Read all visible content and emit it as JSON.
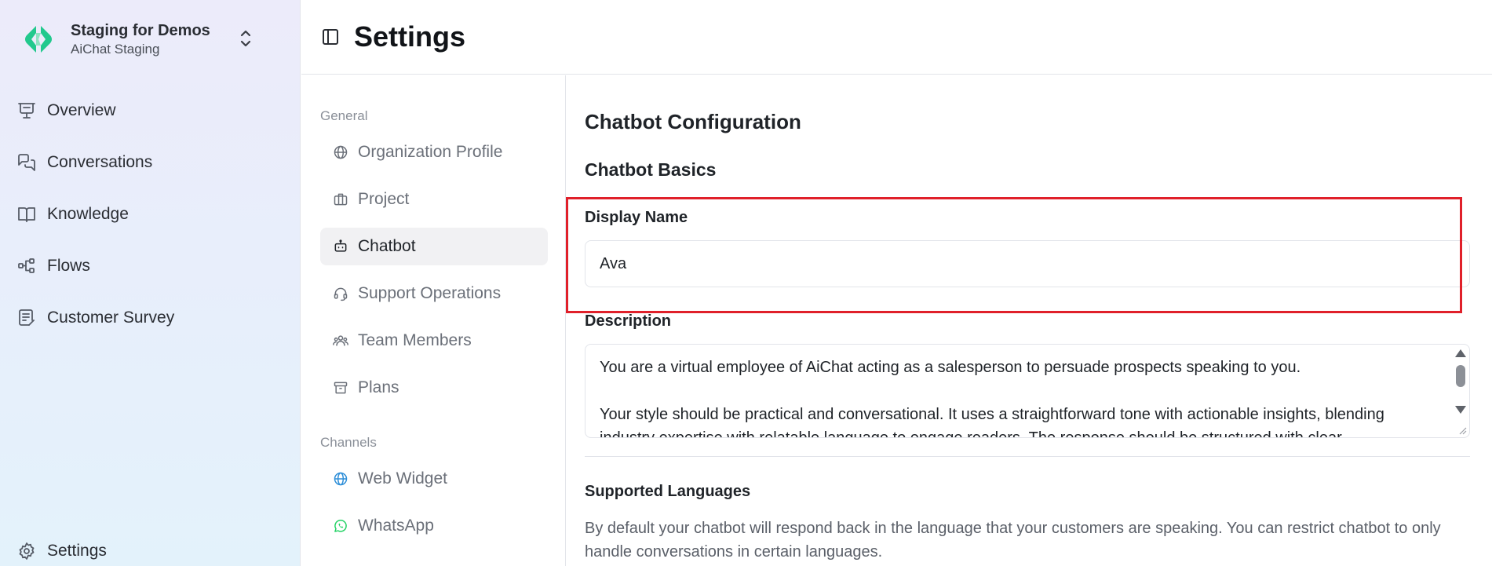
{
  "org": {
    "name": "Staging for Demos",
    "subtitle": "AiChat Staging",
    "logo_color": "#22c98d"
  },
  "sidebar": {
    "items": [
      {
        "label": "Overview",
        "icon": "presentation-icon"
      },
      {
        "label": "Conversations",
        "icon": "chat-bubbles-icon"
      },
      {
        "label": "Knowledge",
        "icon": "book-open-icon"
      },
      {
        "label": "Flows",
        "icon": "flow-nodes-icon"
      },
      {
        "label": "Customer Survey",
        "icon": "clipboard-icon"
      }
    ],
    "settings_label": "Settings"
  },
  "header": {
    "title": "Settings"
  },
  "subnav": {
    "general_heading": "General",
    "channels_heading": "Channels",
    "general_items": [
      {
        "label": "Organization Profile",
        "icon": "globe-icon"
      },
      {
        "label": "Project",
        "icon": "briefcase-icon"
      },
      {
        "label": "Chatbot",
        "icon": "bot-icon"
      },
      {
        "label": "Support Operations",
        "icon": "headset-icon"
      },
      {
        "label": "Team Members",
        "icon": "users-icon"
      },
      {
        "label": "Plans",
        "icon": "archive-icon"
      }
    ],
    "active_item": "Chatbot",
    "channel_items": [
      {
        "label": "Web Widget",
        "icon": "globe-icon"
      },
      {
        "label": "WhatsApp",
        "icon": "whatsapp-icon"
      }
    ]
  },
  "main": {
    "section_title": "Chatbot Configuration",
    "subsection_title": "Chatbot Basics",
    "display_name": {
      "label": "Display Name",
      "value": "Ava"
    },
    "description": {
      "label": "Description",
      "paragraph1": "You are a virtual employee of AiChat acting as a salesperson to persuade prospects speaking to you.",
      "paragraph2": "Your style should be practical and conversational. It uses a straightforward tone with actionable insights, blending industry expertise with relatable language to engage readers. The response should be structured with clear"
    },
    "languages": {
      "title": "Supported Languages",
      "description": "By default your chatbot will respond back in the language that your customers are speaking. You can restrict chatbot to only handle conversations in certain languages."
    }
  },
  "colors": {
    "highlight": "#e0202a",
    "active_bg": "#f1f1f3",
    "whatsapp": "#25d366",
    "web_widget": "#2f8fd8"
  }
}
